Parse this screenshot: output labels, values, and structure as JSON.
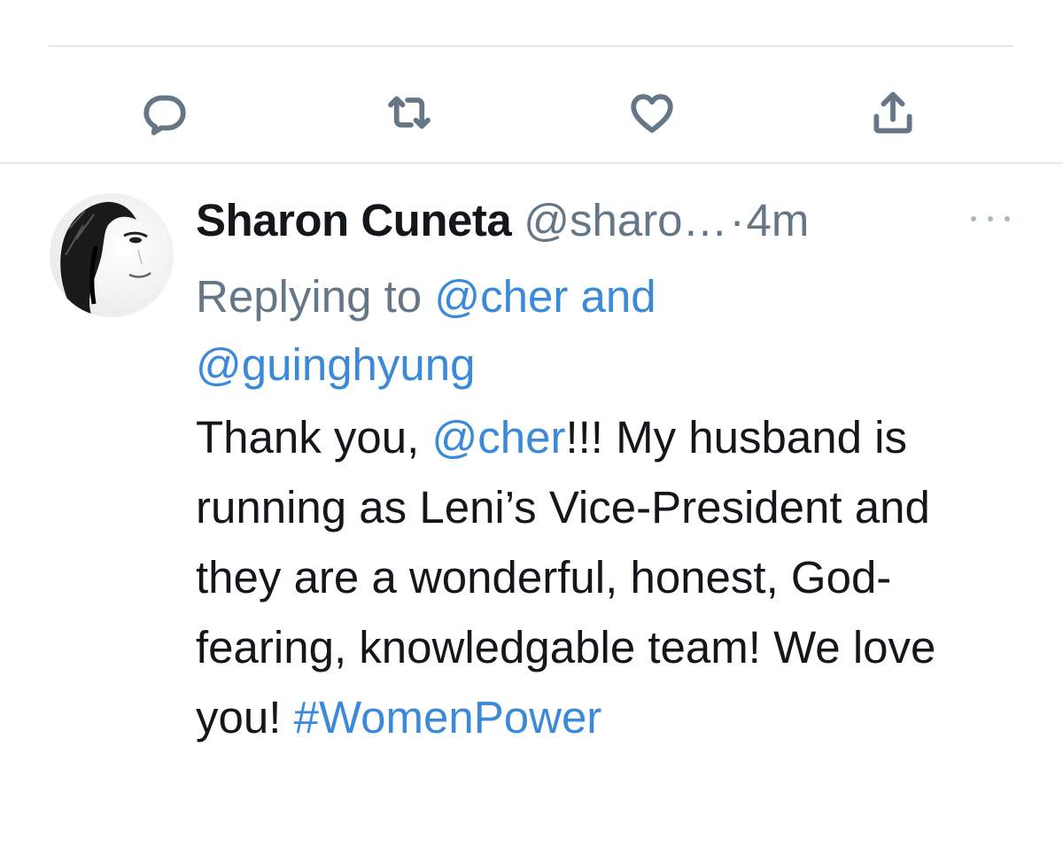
{
  "action_bar": {
    "reply_icon": "reply-icon",
    "retweet_icon": "retweet-icon",
    "like_icon": "heart-icon",
    "share_icon": "share-icon"
  },
  "tweet": {
    "avatar_icon": "avatar",
    "display_name": "Sharon Cuneta",
    "handle": "@sharo…",
    "separator": "·",
    "time": "4m",
    "more_icon": "more-dots-icon",
    "replying": {
      "prefix": "Replying to ",
      "mention_1": "@cher",
      "and_text": " and",
      "mention_2": "@guinghyung"
    },
    "body": {
      "part_1": "Thank you, ",
      "mention": "@cher",
      "part_2": "!!! My husband is running as Leni’s Vice-President and they are a wonderful, honest, God-fearing, knowledgable team! We love you! ",
      "hashtag": "#WomenPower"
    }
  },
  "colors": {
    "link": "#3b8ad9",
    "secondary_text": "#657786",
    "primary_text": "#14171a",
    "divider": "#e1e8ed"
  }
}
